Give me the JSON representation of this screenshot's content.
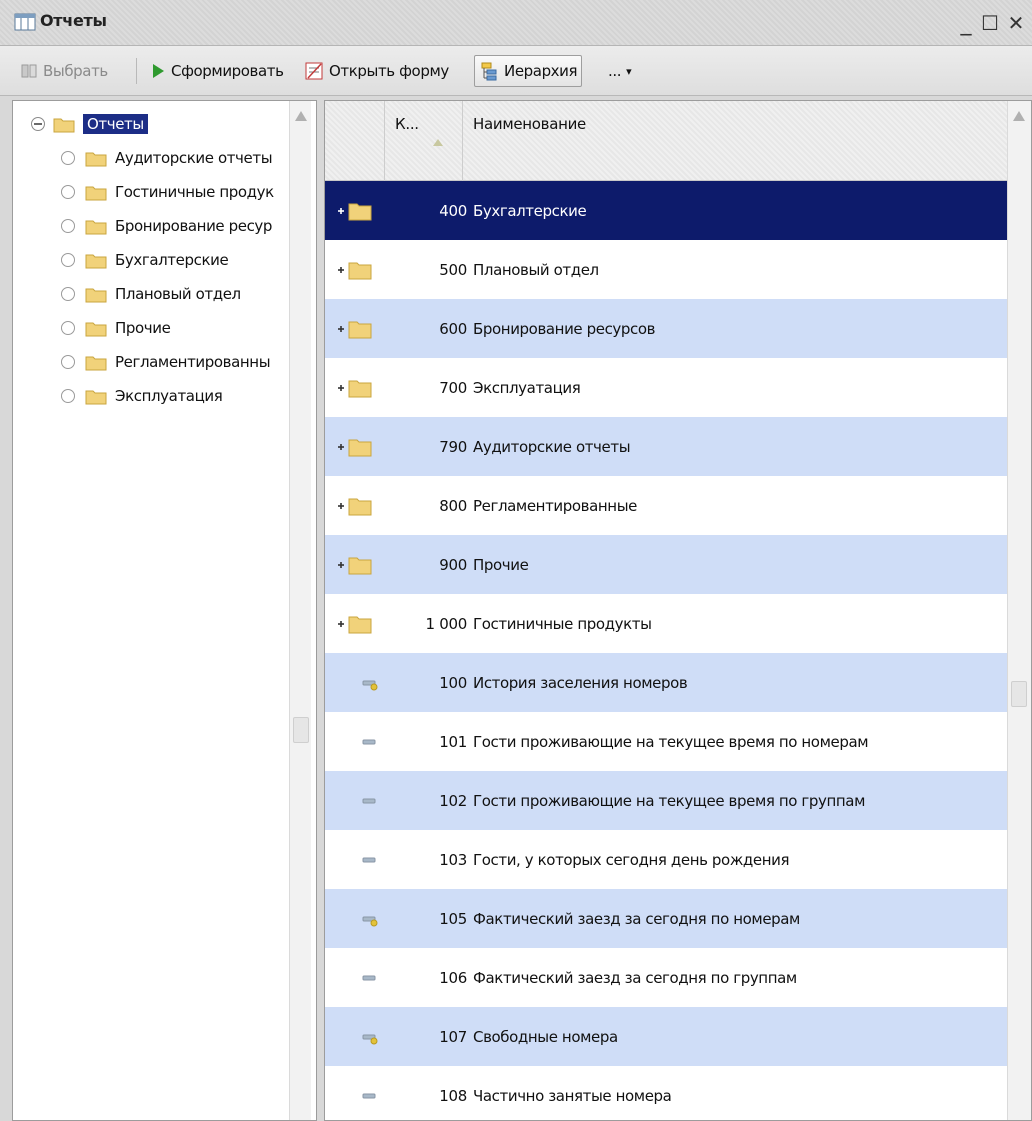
{
  "window": {
    "title": "Отчеты",
    "minimize": "_",
    "maximize": "☐",
    "close": "✕"
  },
  "toolbar": {
    "select_label": "Выбрать",
    "generate_label": "Сформировать",
    "open_form_label": "Открыть форму",
    "hierarchy_label": "Иерархия",
    "more_label": "...",
    "more_arrow": "▾"
  },
  "tree": {
    "root": "Отчеты",
    "items": [
      "Аудиторские отчеты",
      "Гостиничные продук",
      "Бронирование ресур",
      "Бухгалтерские",
      "Плановый отдел",
      "Прочие",
      "Регламентированны",
      "Эксплуатация"
    ]
  },
  "grid": {
    "columns": {
      "code": "К...",
      "name": "Наименование"
    },
    "rows": [
      {
        "kind": "folder",
        "code": "400",
        "name": "Бухгалтерские",
        "selected": true
      },
      {
        "kind": "folder",
        "code": "500",
        "name": "Плановый отдел"
      },
      {
        "kind": "folder",
        "code": "600",
        "name": "Бронирование ресурсов"
      },
      {
        "kind": "folder",
        "code": "700",
        "name": "Эксплуатация"
      },
      {
        "kind": "folder",
        "code": "790",
        "name": "Аудиторские отчеты"
      },
      {
        "kind": "folder",
        "code": "800",
        "name": "Регламентированные"
      },
      {
        "kind": "folder",
        "code": "900",
        "name": "Прочие"
      },
      {
        "kind": "folder",
        "code": "1 000",
        "name": "Гостиничные продукты"
      },
      {
        "kind": "item-marked",
        "code": "100",
        "name": "История заселения номеров"
      },
      {
        "kind": "item",
        "code": "101",
        "name": "Гости проживающие на текущее время по номерам"
      },
      {
        "kind": "item",
        "code": "102",
        "name": "Гости проживающие на текущее время по группам"
      },
      {
        "kind": "item",
        "code": "103",
        "name": "Гости, у которых сегодня день рождения"
      },
      {
        "kind": "item-marked",
        "code": "105",
        "name": "Фактический заезд за сегодня по номерам"
      },
      {
        "kind": "item",
        "code": "106",
        "name": "Фактический заезд за сегодня по группам"
      },
      {
        "kind": "item-marked",
        "code": "107",
        "name": "Свободные номера"
      },
      {
        "kind": "item",
        "code": "108",
        "name": "Частично занятые номера"
      }
    ]
  },
  "colors": {
    "selection": "#0d1b6b",
    "row_alt": "#cfddf7",
    "folder": "#f1d27a"
  }
}
